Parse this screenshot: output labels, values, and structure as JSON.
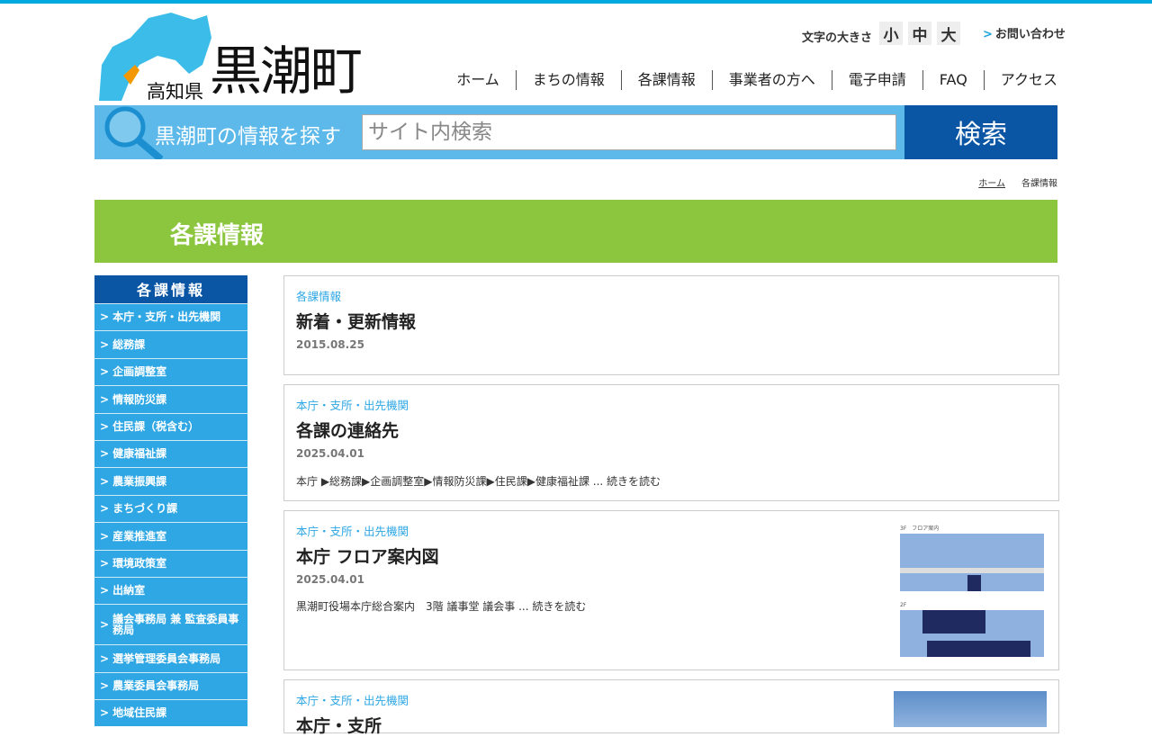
{
  "header": {
    "pref": "高知県",
    "town": "黒潮町",
    "font_size_label": "文字の大きさ",
    "font_sizes": [
      "小",
      "中",
      "大"
    ],
    "contact": "お問い合わせ",
    "contact_arrow": ">"
  },
  "nav": [
    "ホーム",
    "まちの情報",
    "各課情報",
    "事業者の方へ",
    "電子申請",
    "FAQ",
    "アクセス"
  ],
  "search": {
    "label": "黒潮町の情報を探す",
    "placeholder": "サイト内検索",
    "button": "検索"
  },
  "breadcrumb": [
    "ホーム",
    "各課情報"
  ],
  "page_title": "各課情報",
  "sidebar": {
    "title": "各課情報",
    "arrow": ">",
    "items": [
      "本庁・支所・出先機関",
      "総務課",
      "企画調整室",
      "情報防災課",
      "住民課（税含む）",
      "健康福祉課",
      "農業振興課",
      "まちづくり課",
      "産業推進室",
      "環境政策室",
      "出納室",
      "議会事務局 兼 監査委員事務局",
      "選挙管理委員会事務局",
      "農業委員会事務局",
      "地域住民課"
    ]
  },
  "posts": [
    {
      "category": "各課情報",
      "title": "新着・更新情報",
      "date": "2015.08.25",
      "excerpt": ""
    },
    {
      "category": "本庁・支所・出先機関",
      "title": "各課の連絡先",
      "date": "2025.04.01",
      "excerpt": "本庁 ▶総務課▶企画調整室▶情報防災課▶住民課▶健康福祉課 ... 続きを読む"
    },
    {
      "category": "本庁・支所・出先機関",
      "title": "本庁 フロア案内図",
      "date": "2025.04.01",
      "excerpt": "黒潮町役場本庁総合案内　3階 議事堂 議会事 ... 続きを読む",
      "thumb_labels": [
        "3F　フロア案内",
        "2F"
      ]
    },
    {
      "category": "本庁・支所・出先機関",
      "title": "本庁・支所",
      "date": "",
      "excerpt": ""
    }
  ]
}
